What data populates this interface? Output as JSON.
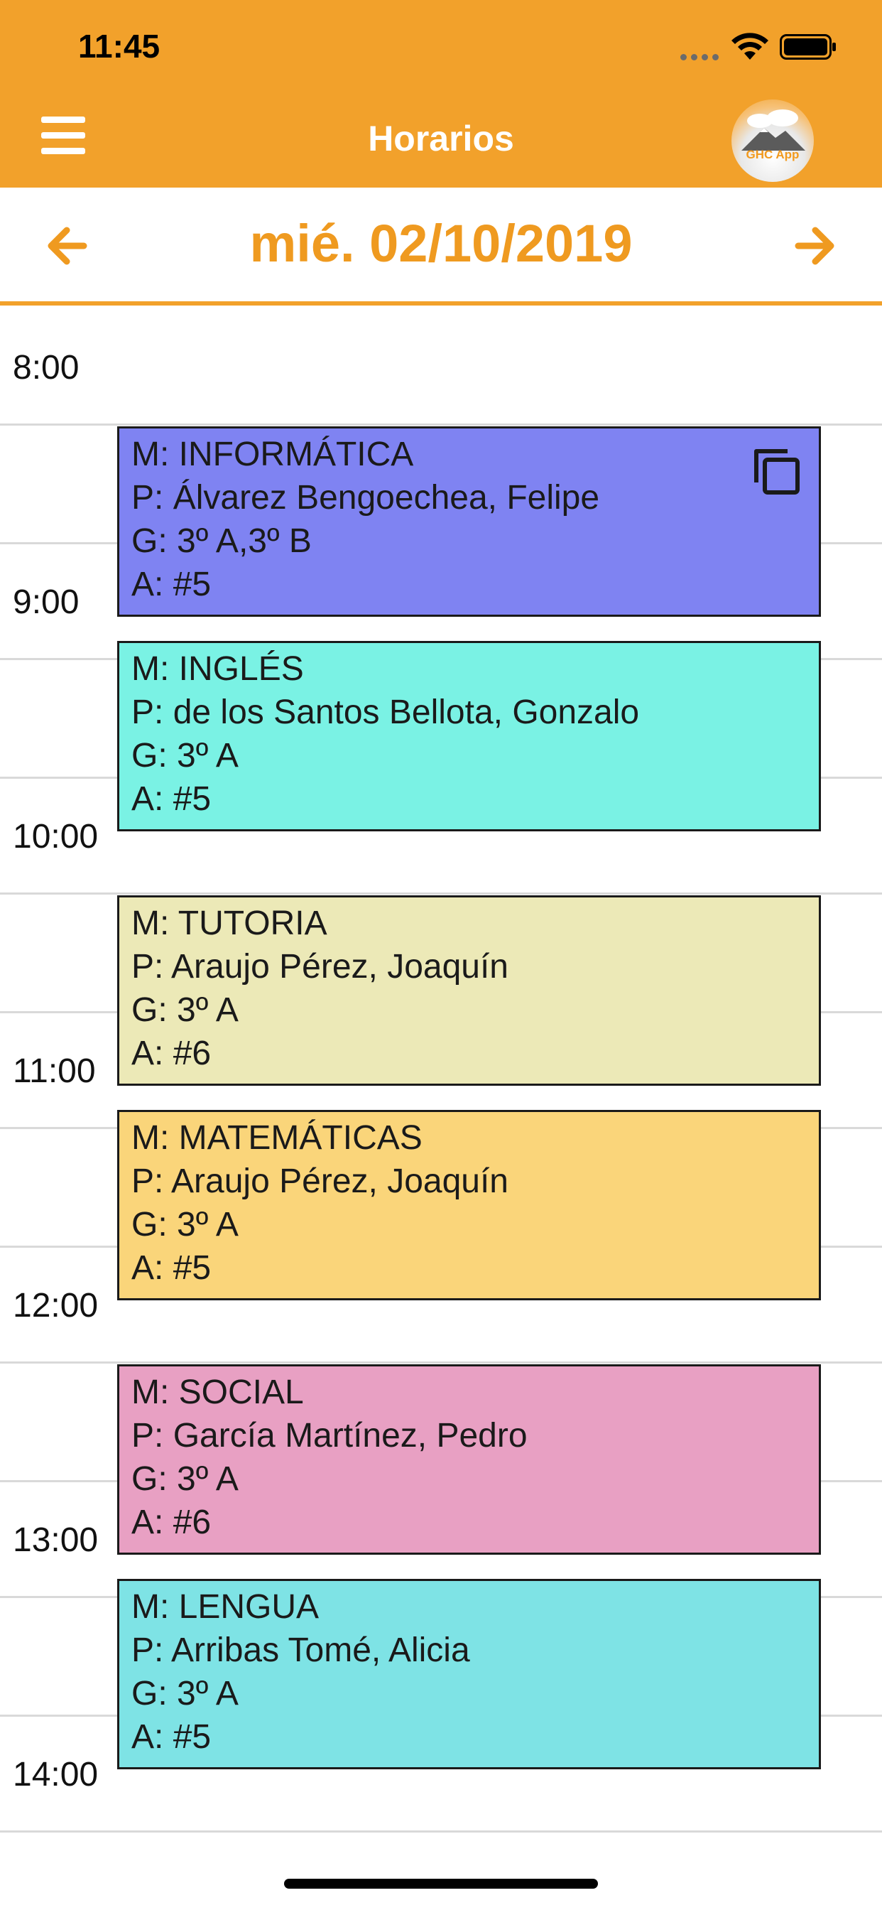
{
  "status_bar": {
    "time": "11:45"
  },
  "header": {
    "title": "Horarios",
    "logo_text": "GHC App",
    "menu_icon": "hamburger-menu-icon"
  },
  "date_nav": {
    "date": "mié. 02/10/2019",
    "prev_icon": "arrow-left-icon",
    "next_icon": "arrow-right-icon"
  },
  "timeline": {
    "hours": [
      "8:00",
      "9:00",
      "10:00",
      "11:00",
      "12:00",
      "13:00",
      "14:00"
    ]
  },
  "events": [
    {
      "materia": "M: INFORMÁTICA",
      "profesor": "P: Álvarez Bengoechea, Felipe",
      "grupo": "G: 3º A,3º B",
      "aula": "A: #5",
      "color": "#7f83f2",
      "icon": "copy-icon"
    },
    {
      "materia": "M: INGLÉS",
      "profesor": "P: de los Santos Bellota, Gonzalo",
      "grupo": "G: 3º A",
      "aula": "A: #5",
      "color": "#7af2e4"
    },
    {
      "materia": "M: TUTORIA",
      "profesor": "P: Araujo Pérez, Joaquín",
      "grupo": "G: 3º A",
      "aula": "A: #6",
      "color": "#ece9b7"
    },
    {
      "materia": "M: MATEMÁTICAS",
      "profesor": "P: Araujo Pérez, Joaquín",
      "grupo": "G: 3º A",
      "aula": "A: #5",
      "color": "#fad57a"
    },
    {
      "materia": "M: SOCIAL",
      "profesor": "P: García Martínez, Pedro",
      "grupo": "G: 3º A",
      "aula": "A: #6",
      "color": "#e8a0c3"
    },
    {
      "materia": "M: LENGUA",
      "profesor": "P: Arribas Tomé, Alicia",
      "grupo": "G: 3º A",
      "aula": "A: #5",
      "color": "#7ee3e5"
    }
  ],
  "colors": {
    "accent": "#f2a12b",
    "date_text": "#ef9a20"
  }
}
